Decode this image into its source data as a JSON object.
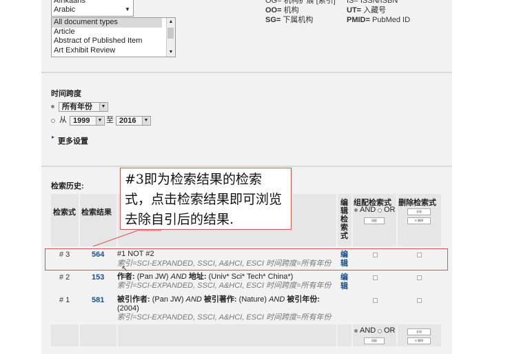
{
  "languages": {
    "options": [
      "Afrikaans",
      "Arabic"
    ]
  },
  "doc_types": {
    "options": [
      "All document types",
      "Article",
      "Abstract of Published Item",
      "Art Exhibit Review"
    ]
  },
  "legend": {
    "og": "OG= 机构扩展 [索引]",
    "oo_k": "OO=",
    "oo_v": " 机构",
    "sg_k": "SG=",
    "sg_v": " 下属机构",
    "is": "IS= ISSN/ISBN",
    "ut_k": "UT=",
    "ut_v": " 入藏号",
    "pmid_k": "PMID=",
    "pmid_v": " PubMed ID"
  },
  "timespan": {
    "title": "时间跨度",
    "all_years": "所有年份",
    "from": "从",
    "from_year": "1999",
    "to": "至",
    "to_year": "2016",
    "more": "更多设置"
  },
  "history": {
    "title": "检索历史:",
    "col_set": "检索式",
    "col_results": "检索结果",
    "col_edit": "编辑检索式",
    "col_combine": "组配检索式",
    "col_delete": "删除检索式",
    "and": "AND",
    "or": "OR",
    "combine_btn": "组配",
    "select_all": "全选",
    "delete_btn": "删除",
    "edit_link": "编辑",
    "rows": [
      {
        "set": "# 3",
        "count": "564",
        "query": "#1 NOT #2",
        "index": "索引=SCI-EXPANDED, SSCI, A&HCI, ESCI 时间跨度=所有年份"
      },
      {
        "set": "# 2",
        "count": "153",
        "query_l1": "作者:",
        "query_v1": " (Pan JW) ",
        "query_and": "AND",
        "query_l2": " 地址:",
        "query_v2": " (Univ* Sci* Tech* China*)",
        "index": "索引=SCI-EXPANDED, SSCI, A&HCI, ESCI 时间跨度=所有年份"
      },
      {
        "set": "# 1",
        "count": "581",
        "query_l1": "被引作者:",
        "query_v1": " (Pan JW) ",
        "query_and": "AND",
        "query_l2": " 被引著作:",
        "query_v2": " (Nature) ",
        "query_and2": "AND",
        "query_l3": " 被引年份:",
        "query_v3": "(2004)",
        "index": "索引=SCI-EXPANDED, SSCI, A&HCI, ESCI 时间跨度=所有年份"
      }
    ]
  },
  "callout": {
    "text": "#3即为检索结果的检索式，点击检索结果即可浏览去除自引后的结果."
  },
  "colors": {
    "accent_red": "#d9534f",
    "link_blue": "#1a4f8b"
  }
}
